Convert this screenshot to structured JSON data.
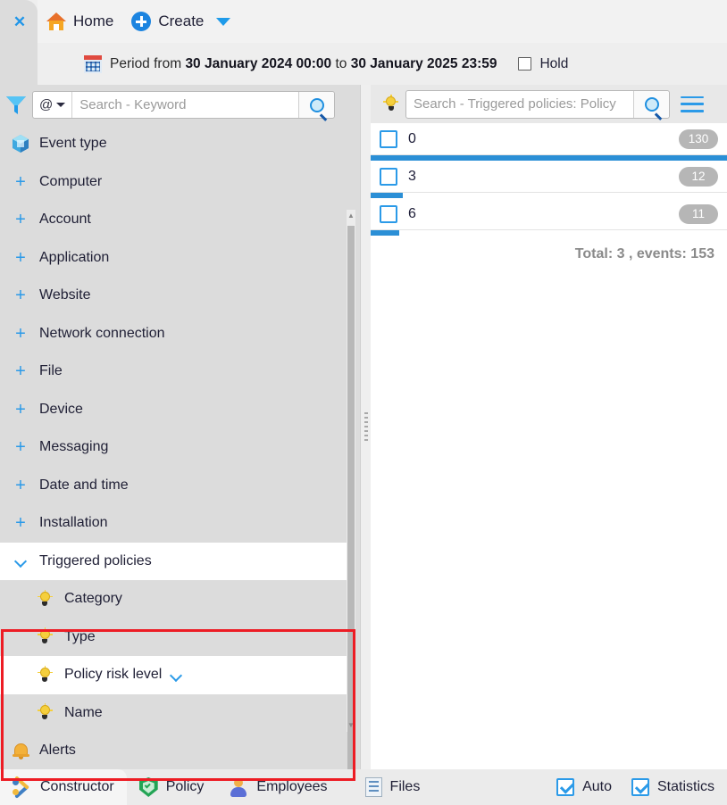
{
  "topbar": {
    "close_tab": "✕",
    "home_label": "Home",
    "create_label": "Create",
    "period_prefix": "Period from",
    "period_from": "30 January 2024 00:00",
    "period_mid": "to",
    "period_to": "30 January 2025 23:59",
    "hold_label": "Hold"
  },
  "left_search": {
    "operator": "@",
    "placeholder": "Search - Keyword"
  },
  "tree": {
    "items": [
      {
        "label": "Event type",
        "icon": "cube-icon",
        "twisty": "none",
        "level": 0,
        "state": "normal"
      },
      {
        "label": "Computer",
        "icon": "none",
        "twisty": "plus",
        "level": 0,
        "state": "normal"
      },
      {
        "label": "Account",
        "icon": "none",
        "twisty": "plus",
        "level": 0,
        "state": "normal"
      },
      {
        "label": "Application",
        "icon": "none",
        "twisty": "plus",
        "level": 0,
        "state": "normal"
      },
      {
        "label": "Website",
        "icon": "none",
        "twisty": "plus",
        "level": 0,
        "state": "normal"
      },
      {
        "label": "Network connection",
        "icon": "none",
        "twisty": "plus",
        "level": 0,
        "state": "normal"
      },
      {
        "label": "File",
        "icon": "none",
        "twisty": "plus",
        "level": 0,
        "state": "normal"
      },
      {
        "label": "Device",
        "icon": "none",
        "twisty": "plus",
        "level": 0,
        "state": "normal"
      },
      {
        "label": "Messaging",
        "icon": "none",
        "twisty": "plus",
        "level": 0,
        "state": "normal"
      },
      {
        "label": "Date and time",
        "icon": "none",
        "twisty": "plus",
        "level": 0,
        "state": "normal"
      },
      {
        "label": "Installation",
        "icon": "none",
        "twisty": "plus",
        "level": 0,
        "state": "normal"
      },
      {
        "label": "Triggered policies",
        "icon": "none",
        "twisty": "chevron",
        "level": 0,
        "state": "white"
      },
      {
        "label": "Category",
        "icon": "bulb-icon",
        "twisty": "none",
        "level": 1,
        "state": "normal"
      },
      {
        "label": "Type",
        "icon": "bulb-icon",
        "twisty": "none",
        "level": 1,
        "state": "normal"
      },
      {
        "label": "Policy risk level",
        "icon": "bulb-icon",
        "twisty": "none",
        "level": 1,
        "state": "white",
        "trailing_chevron": true
      },
      {
        "label": "Name",
        "icon": "bulb-icon",
        "twisty": "none",
        "level": 1,
        "state": "normal"
      },
      {
        "label": "Alerts",
        "icon": "bell-icon",
        "twisty": "none",
        "level": 0,
        "state": "normal"
      }
    ]
  },
  "right_search": {
    "placeholder": "Search - Triggered policies: Policy"
  },
  "list": {
    "rows": [
      {
        "name": "0",
        "count": "130",
        "bar_percent": 100
      },
      {
        "name": "3",
        "count": "12",
        "bar_percent": 9
      },
      {
        "name": "6",
        "count": "11",
        "bar_percent": 8
      }
    ],
    "total_text": "Total: 3 , events: 153"
  },
  "bottombar": {
    "tabs": [
      {
        "label": "Constructor",
        "icon": "tools-icon",
        "active": true
      },
      {
        "label": "Policy",
        "icon": "shield-icon",
        "active": false
      },
      {
        "label": "Employees",
        "icon": "person-icon",
        "active": false
      },
      {
        "label": "Files",
        "icon": "document-icon",
        "active": false
      }
    ],
    "auto_label": "Auto",
    "statistics_label": "Statistics"
  },
  "colors": {
    "accent": "#2b9ae8",
    "bar": "#2b8fd6",
    "highlight_box": "#ed1c24",
    "badge": "#b6b6b6"
  }
}
